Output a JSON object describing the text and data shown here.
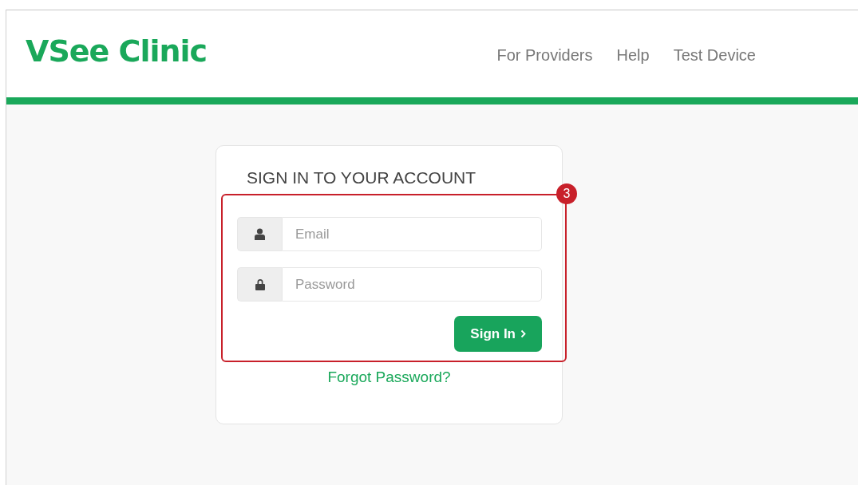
{
  "header": {
    "logo": "VSee Clinic",
    "nav": [
      {
        "label": "For Providers"
      },
      {
        "label": "Help"
      },
      {
        "label": "Test Device"
      }
    ]
  },
  "login": {
    "title": "SIGN IN TO YOUR ACCOUNT",
    "callout": {
      "number": "3"
    },
    "fields": [
      {
        "kind": "user",
        "placeholder": "Email"
      },
      {
        "kind": "lock",
        "placeholder": "Password"
      }
    ],
    "submit": {
      "label": "Sign In"
    },
    "forgot": "Forgot Password?"
  }
}
